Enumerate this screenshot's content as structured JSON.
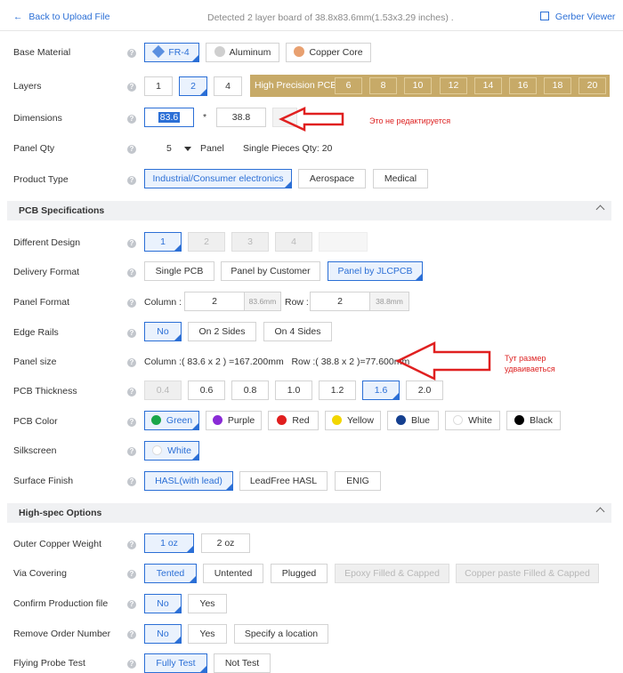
{
  "header": {
    "back_label": "Back to Upload File",
    "detected_text": "Detected 2 layer board of 38.8x83.6mm(1.53x3.29 inches) .",
    "gerber_viewer_label": "Gerber Viewer"
  },
  "labels": {
    "base_material": "Base Material",
    "layers": "Layers",
    "dimensions": "Dimensions",
    "panel_qty": "Panel Qty",
    "product_type": "Product Type",
    "different_design": "Different Design",
    "delivery_format": "Delivery Format",
    "panel_format": "Panel Format",
    "edge_rails": "Edge Rails",
    "panel_size": "Panel size",
    "pcb_thickness": "PCB Thickness",
    "pcb_color": "PCB Color",
    "silkscreen": "Silkscreen",
    "surface_finish": "Surface Finish",
    "outer_copper_weight": "Outer Copper Weight",
    "via_covering": "Via Covering",
    "confirm_production_file": "Confirm Production file",
    "remove_order_number": "Remove Order Number",
    "flying_probe_test": "Flying Probe Test"
  },
  "base_material": [
    "FR-4",
    "Aluminum",
    "Copper Core"
  ],
  "layers": [
    "1",
    "2",
    "4"
  ],
  "high_precision": {
    "title": "High Precision PCB",
    "options": [
      "6",
      "8",
      "10",
      "12",
      "14",
      "16",
      "18",
      "20"
    ]
  },
  "dimensions": {
    "width": "83.6",
    "separator": "*",
    "height": "38.8"
  },
  "annotations": {
    "not_editable": "Это не редактируется",
    "size_doubles_line1": "Тут размер",
    "size_doubles_line2": "удваиваеться"
  },
  "panel_qty": {
    "value": "5",
    "unit": "Panel",
    "single_pieces": "Single Pieces Qty: 20"
  },
  "product_type": [
    "Industrial/Consumer electronics",
    "Aerospace",
    "Medical"
  ],
  "sections": {
    "pcb_specs": "PCB Specifications",
    "high_spec": "High-spec Options"
  },
  "different_design": [
    "1",
    "2",
    "3",
    "4"
  ],
  "delivery_format": [
    "Single PCB",
    "Panel by Customer",
    "Panel by JLCPCB"
  ],
  "panel_format": {
    "column_label": "Column :",
    "column_value": "2",
    "column_unit": "83.6mm",
    "row_label": "Row :",
    "row_value": "2",
    "row_unit": "38.8mm"
  },
  "edge_rails": [
    "No",
    "On 2 Sides",
    "On 4 Sides"
  ],
  "panel_size": {
    "text": "Column :( 83.6 x 2 ) =167.200mm   Row :( 38.8 x 2 )=77.600mm"
  },
  "pcb_thickness": [
    "0.4",
    "0.6",
    "0.8",
    "1.0",
    "1.2",
    "1.6",
    "2.0"
  ],
  "pcb_color": [
    {
      "name": "Green",
      "color": "#1aa64a"
    },
    {
      "name": "Purple",
      "color": "#8a2bd6"
    },
    {
      "name": "Red",
      "color": "#e01e1e"
    },
    {
      "name": "Yellow",
      "color": "#f2d600"
    },
    {
      "name": "Blue",
      "color": "#143f8f"
    },
    {
      "name": "White",
      "color": "#ffffff"
    },
    {
      "name": "Black",
      "color": "#000000"
    }
  ],
  "silkscreen": [
    "White"
  ],
  "surface_finish": [
    "HASL(with lead)",
    "LeadFree HASL",
    "ENIG"
  ],
  "outer_copper_weight": [
    "1 oz",
    "2 oz"
  ],
  "via_covering": [
    "Tented",
    "Untented",
    "Plugged",
    "Epoxy Filled & Capped",
    "Copper paste Filled & Capped"
  ],
  "confirm_production_file": [
    "No",
    "Yes"
  ],
  "remove_order_number": [
    "No",
    "Yes",
    "Specify a location"
  ],
  "flying_probe_test": [
    "Fully Test",
    "Not Test"
  ],
  "colors": {
    "accent": "#2b6fd6",
    "gold": "#c7aa68",
    "annotation": "#e02020"
  }
}
